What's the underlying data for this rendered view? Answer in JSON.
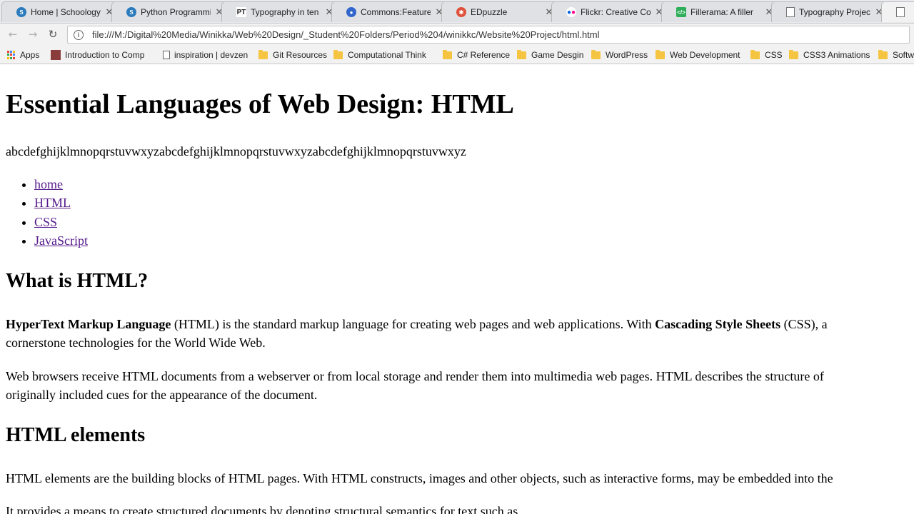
{
  "tabs": [
    {
      "title": "Home | Schoology",
      "fav": "schoology-icon",
      "color": "#2b7bbd"
    },
    {
      "title": "Python Programming",
      "fav": "schoology-icon",
      "color": "#2b7bbd"
    },
    {
      "title": "Typography in ten",
      "fav": "pt-icon",
      "color": "#222222"
    },
    {
      "title": "Commons:Featured",
      "fav": "commons-icon",
      "color": "#3366cc"
    },
    {
      "title": "EDpuzzle",
      "fav": "edpuzzle-icon",
      "color": "#e0513b"
    },
    {
      "title": "Flickr: Creative Commons",
      "fav": "flickr-icon",
      "color": "#ff0084"
    },
    {
      "title": "Fillerama: A filler",
      "fav": "fillerama-icon",
      "color": "#2fae5a"
    },
    {
      "title": "Typography Project",
      "fav": "page-icon",
      "color": "#777777"
    }
  ],
  "toolbar": {
    "url": "file:///M:/Digital%20Media/Winikka/Web%20Design/_Student%20Folders/Period%204/winikkc/Website%20Project/html.html"
  },
  "bookmarks": [
    {
      "label": "Apps",
      "icon": "apps-icon"
    },
    {
      "label": "Introduction to Comp",
      "icon": "site-icon"
    },
    {
      "label": "inspiration | devzen",
      "icon": "page-icon"
    },
    {
      "label": "Git Resources",
      "icon": "folder-icon"
    },
    {
      "label": "Computational Think",
      "icon": "folder-icon"
    },
    {
      "label": "C# Reference",
      "icon": "folder-icon"
    },
    {
      "label": "Game Desgin",
      "icon": "folder-icon"
    },
    {
      "label": "WordPress",
      "icon": "folder-icon"
    },
    {
      "label": "Web Development",
      "icon": "folder-icon"
    },
    {
      "label": "CSS",
      "icon": "folder-icon"
    },
    {
      "label": "CSS3 Animations",
      "icon": "folder-icon"
    },
    {
      "label": "Softw",
      "icon": "folder-icon"
    }
  ],
  "page": {
    "title": "Essential Languages of Web Design: HTML",
    "alphabet": "abcdefghijklmnopqrstuvwxyzabcdefghijklmnopqrstuvwxyzabcdefghijklmnopqrstuvwxyz",
    "nav": [
      "home",
      "HTML",
      "CSS",
      "JavaScript"
    ],
    "what_heading": "What is HTML?",
    "p1": {
      "b1": "HyperText Markup Language",
      "t1": " (HTML) is the standard markup language for creating web pages and web applications. With ",
      "b2": "Cascading Style Sheets",
      "t2": " (CSS), a",
      "line2": "cornerstone technologies for the World Wide Web."
    },
    "p2": {
      "line1": "Web browsers receive HTML documents from a webserver or from local storage and render them into multimedia web pages. HTML describes the structure of",
      "line2": "originally included cues for the appearance of the document."
    },
    "elements_heading": "HTML elements",
    "p3": "HTML elements are the building blocks of HTML pages. With HTML constructs, images and other objects, such as interactive forms, may be embedded into the",
    "p4": "It provides a means to create structured documents by denoting structural semantics for text such as"
  }
}
